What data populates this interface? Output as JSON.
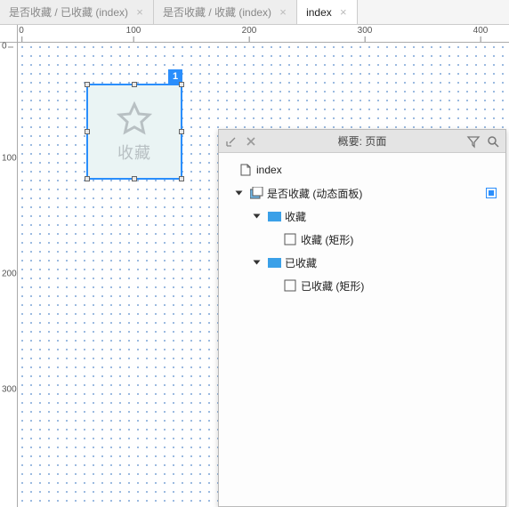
{
  "tabs": [
    {
      "label": "是否收藏 / 已收藏 (index)",
      "active": false
    },
    {
      "label": "是否收藏 / 收藏 (index)",
      "active": false
    },
    {
      "label": "index",
      "active": true
    }
  ],
  "ruler": {
    "h": [
      "0",
      "100",
      "200",
      "300",
      "400"
    ],
    "v": [
      "0",
      "100",
      "200",
      "300"
    ]
  },
  "canvas": {
    "widget_label": "收藏",
    "selection_badge": "1"
  },
  "panel": {
    "title": "概要: 页面",
    "tree": {
      "root": "index",
      "dp": "是否收藏 (动态面板)",
      "state1": "收藏",
      "rect1": "收藏 (矩形)",
      "state2": "已收藏",
      "rect2": "已收藏 (矩形)"
    }
  }
}
